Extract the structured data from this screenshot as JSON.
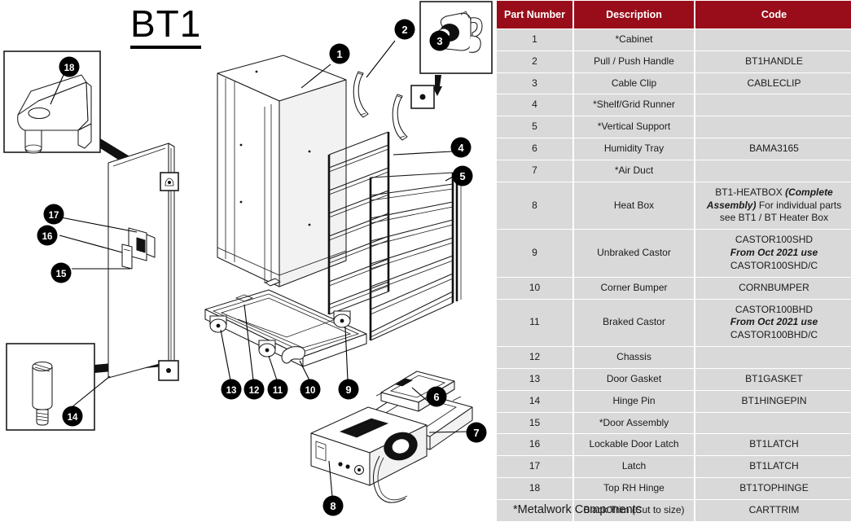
{
  "diagram": {
    "title": "BT1",
    "callouts": [
      {
        "id": "1",
        "label": "1"
      },
      {
        "id": "2",
        "label": "2"
      },
      {
        "id": "3",
        "label": "3"
      },
      {
        "id": "4",
        "label": "4"
      },
      {
        "id": "5",
        "label": "5"
      },
      {
        "id": "6",
        "label": "6"
      },
      {
        "id": "7",
        "label": "7"
      },
      {
        "id": "8",
        "label": "8"
      },
      {
        "id": "9",
        "label": "9"
      },
      {
        "id": "10",
        "label": "10"
      },
      {
        "id": "11",
        "label": "11"
      },
      {
        "id": "12",
        "label": "12"
      },
      {
        "id": "13",
        "label": "13"
      },
      {
        "id": "14",
        "label": "14"
      },
      {
        "id": "15",
        "label": "15"
      },
      {
        "id": "16",
        "label": "16"
      },
      {
        "id": "17",
        "label": "17"
      },
      {
        "id": "18",
        "label": "18"
      }
    ]
  },
  "table": {
    "headers": [
      "Part Number",
      "Description",
      "Code"
    ],
    "rows": [
      {
        "num": "1",
        "desc": "*Cabinet",
        "code": ""
      },
      {
        "num": "2",
        "desc": "Pull / Push Handle",
        "code": "BT1HANDLE"
      },
      {
        "num": "3",
        "desc": "Cable Clip",
        "code": "CABLECLIP"
      },
      {
        "num": "4",
        "desc": "*Shelf/Grid Runner",
        "code": ""
      },
      {
        "num": "5",
        "desc": "*Vertical Support",
        "code": ""
      },
      {
        "num": "6",
        "desc": "Humidity Tray",
        "code": "BAMA3165"
      },
      {
        "num": "7",
        "desc": "*Air Duct",
        "code": ""
      },
      {
        "num": "8",
        "desc": "Heat Box",
        "code_lines": [
          {
            "text": "BT1-HEATBOX ",
            "italic": false
          },
          {
            "text": "(Complete Assembly)",
            "italic": true
          },
          {
            "text": "\nFor individual parts see BT1 / BT Heater Box",
            "italic": false
          }
        ],
        "code_line1_plain": "BT1-HEATBOX ",
        "code_line1_ital": "(Complete Assembly)",
        "code_line2": "For individual parts see BT1 / BT Heater Box"
      },
      {
        "num": "9",
        "desc": "Unbraked Castor",
        "code_line1": "CASTOR100SHD",
        "code_ital": "From Oct 2021 use",
        "code_line3": "CASTOR100SHD/C"
      },
      {
        "num": "10",
        "desc": "Corner Bumper",
        "code": "CORNBUMPER"
      },
      {
        "num": "11",
        "desc": "Braked Castor",
        "code_line1": "CASTOR100BHD",
        "code_ital": "From Oct 2021 use",
        "code_line3": "CASTOR100BHD/C"
      },
      {
        "num": "12",
        "desc": "Chassis",
        "code": ""
      },
      {
        "num": "13",
        "desc": "Door Gasket",
        "code": "BT1GASKET"
      },
      {
        "num": "14",
        "desc": "Hinge Pin",
        "code": "BT1HINGEPIN"
      },
      {
        "num": "15",
        "desc": "*Door Assembly",
        "code": ""
      },
      {
        "num": "16",
        "desc": "Lockable Door Latch",
        "code": "BT1LATCH"
      },
      {
        "num": "17",
        "desc": "Latch",
        "code": "BT1LATCH"
      },
      {
        "num": "18",
        "desc": "Top RH Hinge",
        "code": "BT1TOPHINGE"
      },
      {
        "num": "",
        "desc": "Black Trim (Cut to size)",
        "code": "CARTTRIM"
      }
    ],
    "footnote": "*Metalwork Components"
  },
  "colors": {
    "header_bg": "#990d1a",
    "header_text": "#ffffff",
    "cell_bg": "#d9d9d9",
    "cell_text": "#1a1a1a",
    "line": "#1a1a1a"
  }
}
